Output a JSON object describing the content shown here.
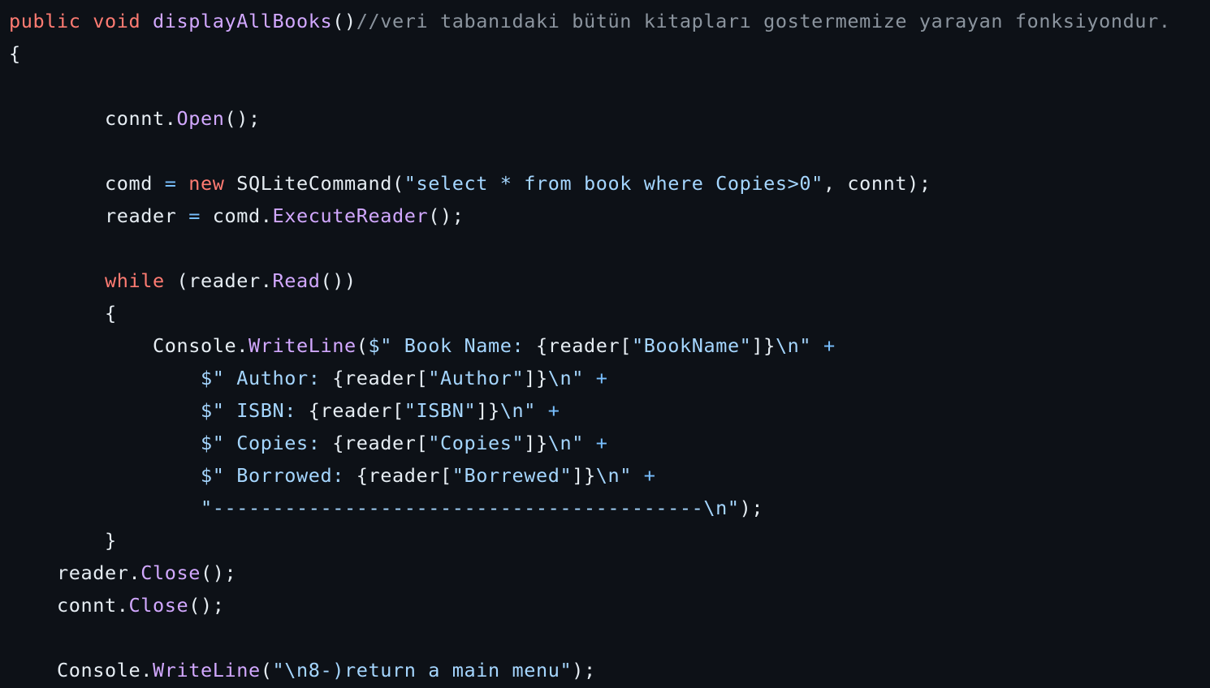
{
  "editor": {
    "theme_colors": {
      "background": "#0d1117",
      "keyword": "#ff7b72",
      "identifier": "#e6edf3",
      "function": "#d2a8ff",
      "string": "#a5d6ff",
      "comment": "#8b949e",
      "operator": "#79c0ff"
    },
    "lines": [
      {
        "text": "public void displayAllBooks()//veri tabanıdaki bütün kitapları gostermemize yarayan fonksiyondur."
      },
      {
        "text": "{"
      },
      {
        "text": ""
      },
      {
        "text": "        connt.Open();"
      },
      {
        "text": ""
      },
      {
        "text": "        comd = new SQLiteCommand(\"select * from book where Copies>0\", connt);"
      },
      {
        "text": "        reader = comd.ExecuteReader();"
      },
      {
        "text": ""
      },
      {
        "text": "        while (reader.Read())"
      },
      {
        "text": "        {"
      },
      {
        "text": "            Console.WriteLine($\" Book Name: {reader[\"BookName\"]}\\n\" +"
      },
      {
        "text": "                $\" Author: {reader[\"Author\"]}\\n\" +"
      },
      {
        "text": "                $\" ISBN: {reader[\"ISBN\"]}\\n\" +"
      },
      {
        "text": "                $\" Copies: {reader[\"Copies\"]}\\n\" +"
      },
      {
        "text": "                $\" Borrowed: {reader[\"Borrewed\"]}\\n\" +"
      },
      {
        "text": "                \"-----------------------------------------\\n\");"
      },
      {
        "text": "        }"
      },
      {
        "text": "    reader.Close();"
      },
      {
        "text": "    connt.Close();"
      },
      {
        "text": ""
      },
      {
        "text": "    Console.WriteLine(\"\\n8-)return a main menu\");"
      }
    ]
  }
}
